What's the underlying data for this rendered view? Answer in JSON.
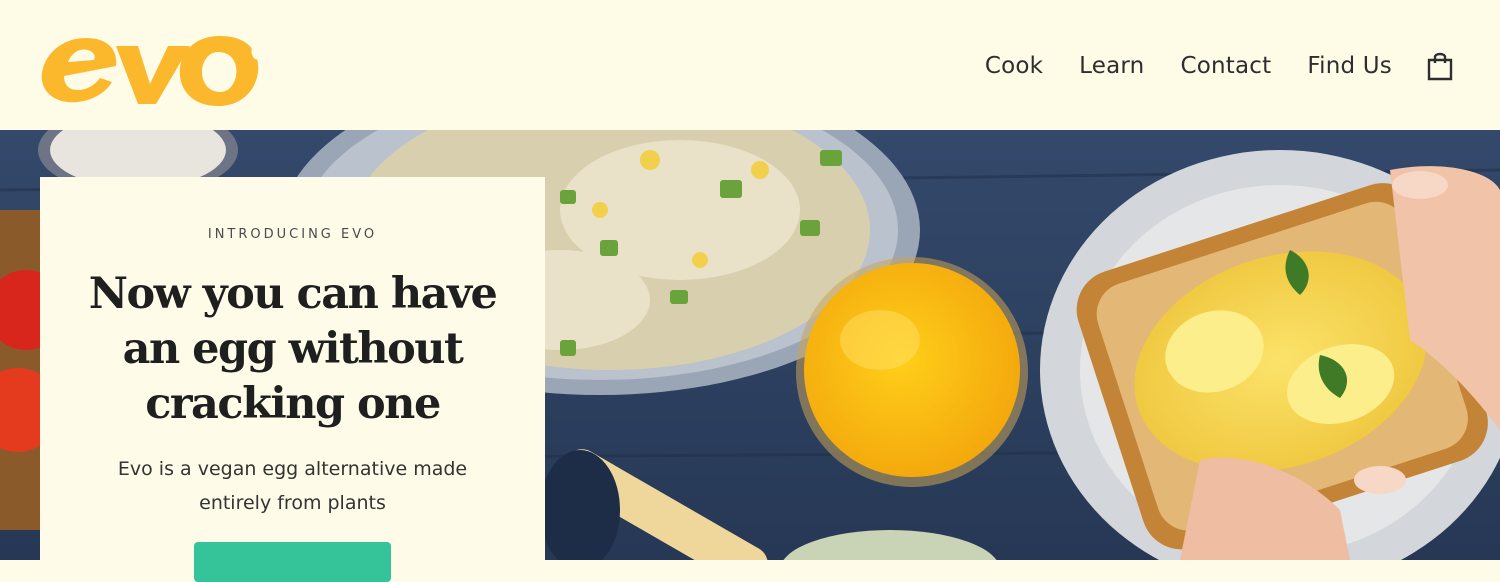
{
  "brand": {
    "logo_text": "evo",
    "logo_color": "#fbb82c"
  },
  "nav": {
    "items": [
      {
        "label": "Cook"
      },
      {
        "label": "Learn"
      },
      {
        "label": "Contact"
      },
      {
        "label": "Find Us"
      }
    ],
    "cart_icon": "shopping-bag-icon"
  },
  "hero": {
    "eyebrow": "INTRODUCING EVO",
    "headline": "Now you can have an egg without cracking one",
    "subtext": "Evo is a vegan egg alternative made entirely from plants",
    "cta_color": "#35c49a"
  },
  "colors": {
    "header_bg": "#fefbe6",
    "table_blue": "#2f4466",
    "accent": "#fbb82c"
  }
}
